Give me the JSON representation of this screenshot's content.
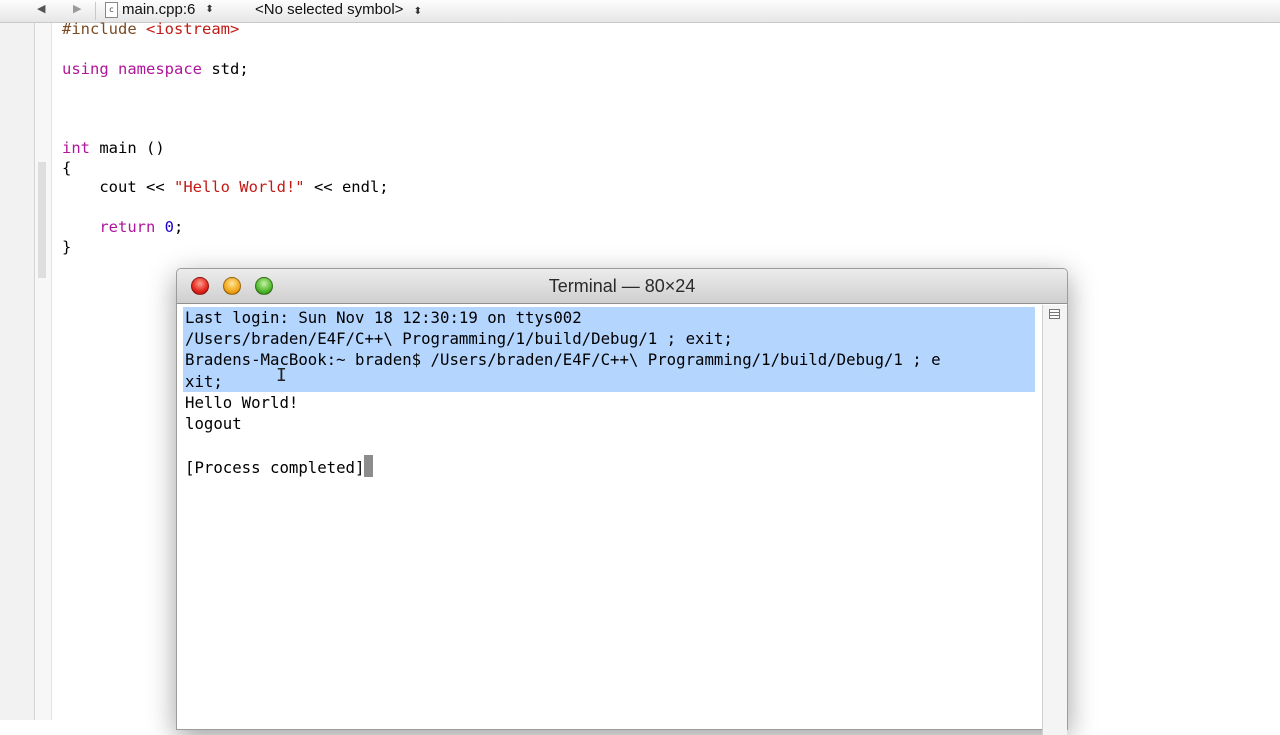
{
  "navbar": {
    "back_glyph": "◀",
    "forward_glyph": "▶",
    "file_icon_glyph": "c",
    "file": "main.cpp:6",
    "symbol": "<No selected symbol>",
    "updown": "⬍"
  },
  "editor": {
    "lines": [
      [
        {
          "t": "#include ",
          "c": "pp"
        },
        {
          "t": "<iostream>",
          "c": "inc"
        }
      ],
      [],
      [
        {
          "t": "using",
          "c": "kw"
        },
        {
          "t": " "
        },
        {
          "t": "namespace",
          "c": "kw"
        },
        {
          "t": " std;"
        }
      ],
      [],
      [],
      [],
      [
        {
          "t": "int",
          "c": "kw"
        },
        {
          "t": " main ()"
        }
      ],
      [
        {
          "t": "{"
        }
      ],
      [
        {
          "t": "    cout << "
        },
        {
          "t": "\"Hello World!\"",
          "c": "str"
        },
        {
          "t": " << endl;"
        }
      ],
      [],
      [
        {
          "t": "    "
        },
        {
          "t": "return",
          "c": "kw"
        },
        {
          "t": " "
        },
        {
          "t": "0",
          "c": "num"
        },
        {
          "t": ";"
        }
      ],
      [
        {
          "t": "}"
        }
      ]
    ]
  },
  "terminal": {
    "title": "Terminal — 80×24",
    "lines": [
      {
        "text": "Last login: Sun Nov 18 12:30:19 on ttys002",
        "selected": true
      },
      {
        "text": "/Users/braden/E4F/C++\\ Programming/1/build/Debug/1 ; exit;",
        "selected": true
      },
      {
        "text": "Bradens-MacBook:~ braden$ /Users/braden/E4F/C++\\ Programming/1/build/Debug/1 ; e",
        "selected": true
      },
      {
        "text": "xit;",
        "selected": true
      },
      {
        "text": "Hello World!",
        "selected": false
      },
      {
        "text": "logout",
        "selected": false
      },
      {
        "text": "",
        "selected": false
      },
      {
        "text": "[Process completed]",
        "selected": false,
        "cursor": true
      }
    ]
  },
  "colors": {
    "selection": "#b4d5fe",
    "keyword": "#b0169b",
    "string": "#c41a16",
    "number": "#1c00cf"
  }
}
